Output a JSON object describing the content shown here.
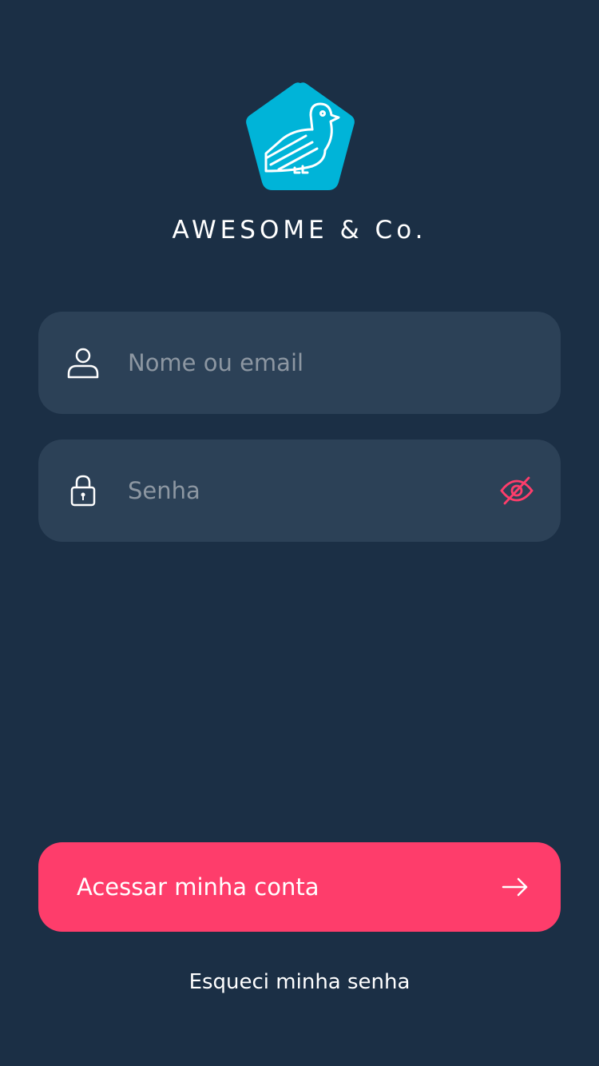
{
  "brand": {
    "logo_icon": "bird-pentagon-logo",
    "name": "AWESOME & Co."
  },
  "login_form": {
    "username": {
      "icon": "user-icon",
      "placeholder": "Nome ou email",
      "value": ""
    },
    "password": {
      "icon": "lock-icon",
      "placeholder": "Senha",
      "value": "",
      "toggle_icon": "eye-off-icon"
    }
  },
  "actions": {
    "submit_label": "Acessar minha conta",
    "submit_icon": "arrow-right-icon",
    "forgot_label": "Esqueci minha senha"
  },
  "colors": {
    "background": "#1b2f45",
    "field_background": "#2c4157",
    "brand_accent": "#00b4d8",
    "primary_button": "#fe3d6b",
    "eye_icon": "#fe3d6b",
    "placeholder_text": "#8d97a2"
  }
}
